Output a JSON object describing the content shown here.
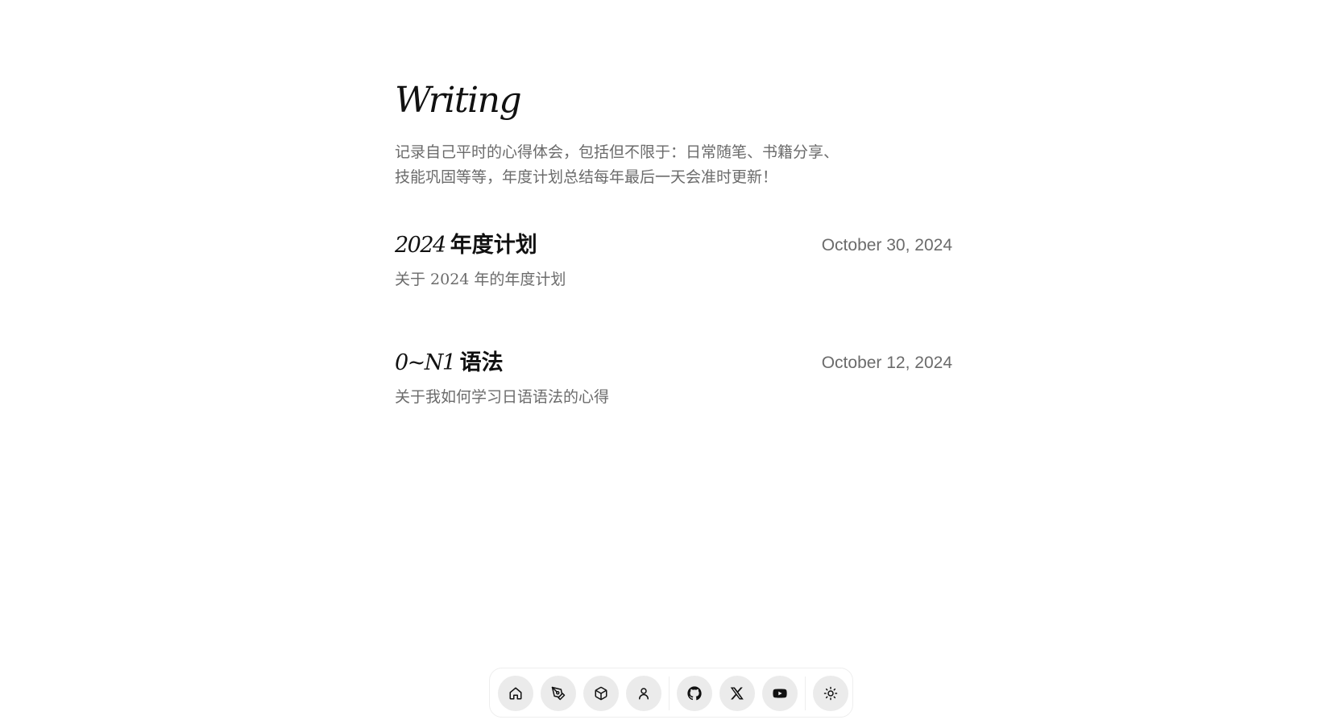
{
  "page": {
    "title": "Writing",
    "intro": "记录自己平时的心得体会，包括但不限于：日常随笔、书籍分享、技能巩固等等，年度计划总结每年最后一天会准时更新！"
  },
  "posts": [
    {
      "title_num": "2024",
      "title_word": "年度计划",
      "date": "October 30, 2024",
      "description": "关于 2024 年的年度计划"
    },
    {
      "title_num": "0~N1",
      "title_word": "语法",
      "date": "October 12, 2024",
      "description": "关于我如何学习日语语法的心得"
    }
  ],
  "dock": {
    "items": [
      {
        "icon": "home-icon"
      },
      {
        "icon": "pen-icon"
      },
      {
        "icon": "box-icon"
      },
      {
        "icon": "user-icon"
      },
      {
        "icon": "github-icon"
      },
      {
        "icon": "x-icon"
      },
      {
        "icon": "youtube-icon"
      },
      {
        "icon": "sun-icon"
      }
    ]
  },
  "colors": {
    "text": "#111111",
    "muted": "#6b6b6b",
    "dock_button": "#ebebeb"
  }
}
